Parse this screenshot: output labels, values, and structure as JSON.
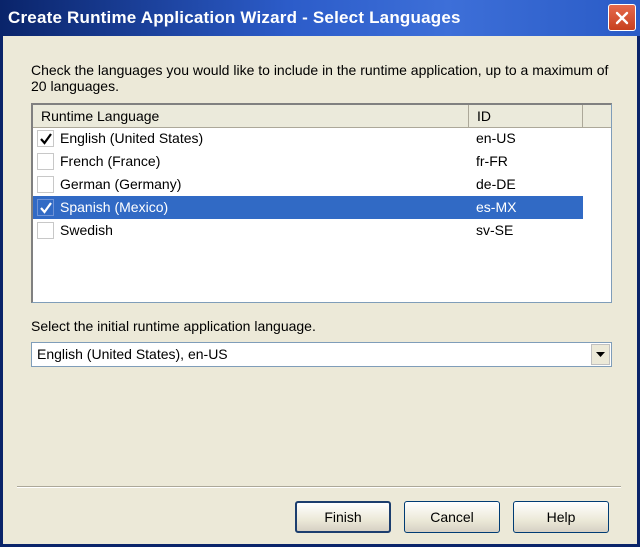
{
  "window": {
    "title": "Create Runtime Application Wizard - Select Languages"
  },
  "instructions": "Check the languages you would like to include in the runtime application, up to a maximum of 20 languages.",
  "language_list": {
    "columns": [
      "Runtime Language",
      "ID"
    ],
    "rows": [
      {
        "language": "English (United States)",
        "id": "en-US",
        "checked": true,
        "selected": false
      },
      {
        "language": "French (France)",
        "id": "fr-FR",
        "checked": false,
        "selected": false
      },
      {
        "language": "German (Germany)",
        "id": "de-DE",
        "checked": false,
        "selected": false
      },
      {
        "language": "Spanish (Mexico)",
        "id": "es-MX",
        "checked": true,
        "selected": true
      },
      {
        "language": "Swedish",
        "id": "sv-SE",
        "checked": false,
        "selected": false
      }
    ]
  },
  "initial_language": {
    "label": "Select the initial runtime application language.",
    "value": "English (United States), en-US"
  },
  "buttons": {
    "finish": "Finish",
    "cancel": "Cancel",
    "help": "Help"
  },
  "icons": {
    "close": "close-icon",
    "check": "checkmark-icon",
    "dropdown": "chevron-down-icon"
  },
  "colors": {
    "selection": "#316ac5",
    "title_bar": "#0a246a",
    "dialog_bg": "#ece9d8"
  }
}
